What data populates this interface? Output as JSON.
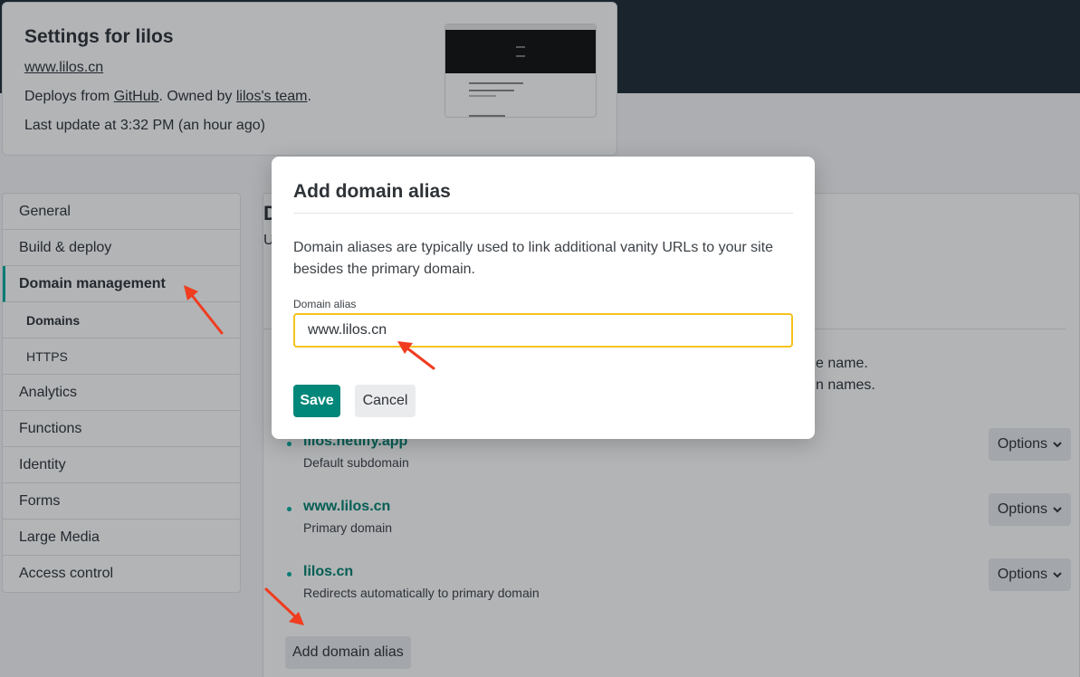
{
  "site": {
    "title": "Settings for lilos",
    "url": "www.lilos.cn",
    "deploys_prefix": "Deploys from ",
    "deploys_provider": "GitHub",
    "owned_prefix": ". Owned by ",
    "team": "lilos's team",
    "owned_suffix": ".",
    "last_update": "Last update at 3:32 PM (an hour ago)"
  },
  "sidebar": {
    "items": [
      {
        "label": "General"
      },
      {
        "label": "Build & deploy"
      },
      {
        "label": "Domain management"
      },
      {
        "label": "Domains"
      },
      {
        "label": "HTTPS"
      },
      {
        "label": "Analytics"
      },
      {
        "label": "Functions"
      },
      {
        "label": "Identity"
      },
      {
        "label": "Forms"
      },
      {
        "label": "Large Media"
      },
      {
        "label": "Access control"
      }
    ]
  },
  "main": {
    "heading": "D",
    "subtitle": "U",
    "tail_line1": "e name.",
    "tail_line2": "n names.",
    "domains": [
      {
        "name": "lilos.netlify.app",
        "description": "Default subdomain",
        "options_label": "Options"
      },
      {
        "name": "www.lilos.cn",
        "description": "Primary domain",
        "options_label": "Options"
      },
      {
        "name": "lilos.cn",
        "description": "Redirects automatically to primary domain",
        "options_label": "Options"
      }
    ],
    "add_alias_label": "Add domain alias"
  },
  "modal": {
    "title": "Add domain alias",
    "description": "Domain aliases are typically used to link additional vanity URLs to your site besides the primary domain.",
    "field_label": "Domain alias",
    "field_value": "www.lilos.cn",
    "save_label": "Save",
    "cancel_label": "Cancel"
  },
  "colors": {
    "accent": "#00877a",
    "link": "#00816f",
    "focus": "#f5c21d",
    "annotation_arrow": "#f03c1f"
  }
}
